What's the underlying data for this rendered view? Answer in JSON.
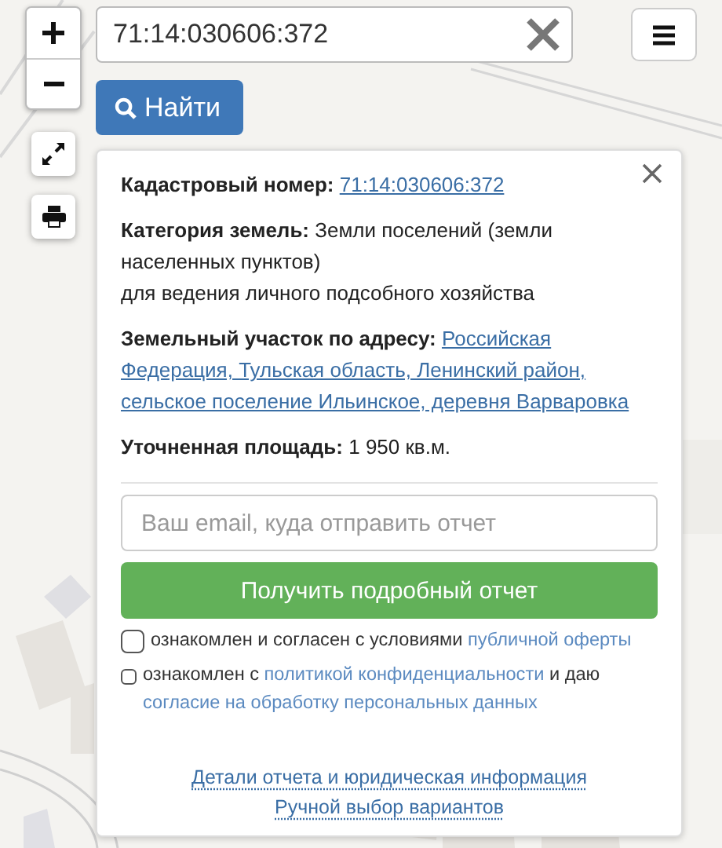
{
  "search": {
    "value": "71:14:030606:372"
  },
  "find_button": "Найти",
  "info": {
    "cadastral_label": "Кадастровый номер:",
    "cadastral_link": "71:14:030606:372",
    "category": "**Категория земель:** Земли поселений (земли населенных пунктов)",
    "usage": "для ведения личного подсобного хозяйства",
    "address_label": "Земельный участок по адресу:",
    "address_lines": [
      "Российская",
      "Федерация, Тульская область, Ленинский район,",
      "сельское поселение Ильинское, деревня Варваровка"
    ],
    "area": "**Уточненная площадь:** 1 950 кв.м."
  },
  "email": {
    "placeholder": "Ваш email, куда отправить отчет"
  },
  "report_button": "Получить подробный отчет",
  "agreements": [
    {
      "checked": false,
      "kind": "large",
      "parts": [
        {
          "text": "ознакомлен и согласен с условиями",
          "kind": "text"
        },
        {
          "text": "публичной оферты",
          "kind": "link"
        }
      ]
    },
    {
      "checked": false,
      "kind": "small",
      "parts": [
        {
          "text": "ознакомлен с",
          "kind": "text"
        },
        {
          "text": "политикой конфиденциальности",
          "kind": "link"
        },
        {
          "text": "и даю",
          "kind": "text"
        },
        {
          "text": "согласие на обработку персональных данных",
          "kind": "link"
        }
      ]
    }
  ],
  "footer_links": [
    "Детали отчета и юридическая информация",
    "Ручной выбор вариантов"
  ]
}
